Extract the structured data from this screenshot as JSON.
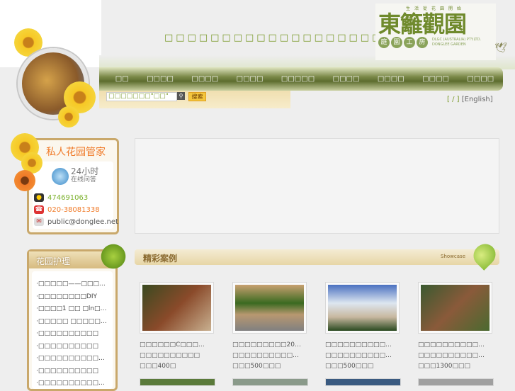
{
  "header": {
    "slogan": "□□□□□□□□□□□□□□□□□□□□□",
    "logo": {
      "tagline": "生活從花園開始",
      "name": "東籬觀園",
      "sub": [
        "庭",
        "園",
        "工",
        "房"
      ],
      "en1": "DLGC (AUSTRALIA) PTY.LTD.",
      "en2": "DONGLEE GARDEN"
    }
  },
  "nav": [
    "□□",
    "□□□□",
    "□□□□",
    "□□□□",
    "□□□□□",
    "□□□□",
    "□□□□",
    "□□□□",
    "□□□□"
  ],
  "search": {
    "value": "□□□□□□□\"□□\"",
    "button": "搜索"
  },
  "lang": {
    "open": "[",
    "cn": " / ",
    "close": "]",
    "en": "[English]"
  },
  "butler": {
    "title": "私人花园管家",
    "hours": "24小时",
    "online": "在线问答",
    "qq": "474691063",
    "phone": "020-38081338",
    "email": "public@donglee.net"
  },
  "care": {
    "title": "花园护理",
    "items": [
      "·□□□□□——□□□…",
      "·□□□□□□□□DIY",
      "·□□□□1 □□ □ln□…",
      "·□□□□□ □□□□□…",
      "·□□□□□□□□□□",
      "·□□□□□□□□□□",
      "·□□□□□□□□□□…",
      "·□□□□□□□□□□",
      "·□□□□□□□□□□…"
    ]
  },
  "cases": {
    "title": "精彩案例",
    "showcase": "Showcase",
    "items": [
      {
        "l1": "□□□□□□C□□□…",
        "l2": "□□□□□□□□□□",
        "l3": "□□□400□"
      },
      {
        "l1": "□□□□□□□□□20…",
        "l2": "□□□□□□□□□□…",
        "l3": "□□□500□□□"
      },
      {
        "l1": "□□□□□□□□□□…",
        "l2": "□□□□□□□□□□…",
        "l3": "□□□500□□□"
      },
      {
        "l1": "□□□□□□□□□□…",
        "l2": "□□□□□□□□□□…",
        "l3": "□□□1300□□□"
      }
    ]
  }
}
